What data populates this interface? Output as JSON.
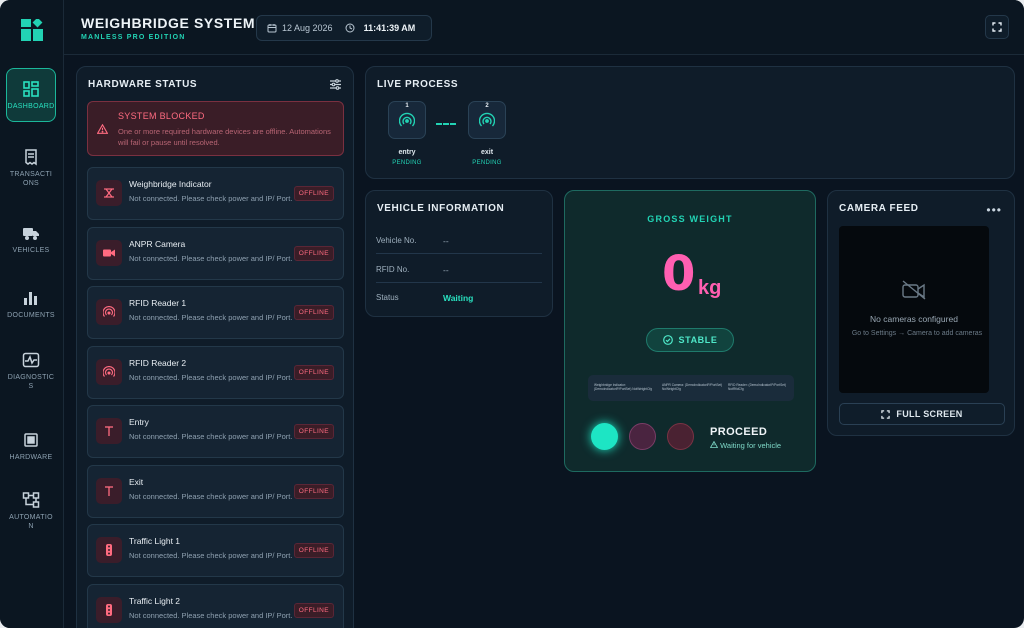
{
  "header": {
    "title": "WEIGHBRIDGE SYSTEM",
    "subtitle": "MANLESS PRO EDITION",
    "date": "12 Aug 2026",
    "time": "11:41:39 AM"
  },
  "sidebar": {
    "items": [
      {
        "label": "DASHBOARD",
        "icon": "dashboard-icon",
        "active": true
      },
      {
        "label": "TRANSACTIONS",
        "icon": "receipt-icon"
      },
      {
        "label": "VEHICLES",
        "icon": "truck-icon"
      },
      {
        "label": "DOCUMENTS",
        "icon": "bar-chart-icon"
      },
      {
        "label": "DIAGNOSTICS",
        "icon": "pulse-icon"
      },
      {
        "label": "HARDWARE",
        "icon": "chip-icon"
      },
      {
        "label": "AUTOMATION",
        "icon": "workflow-icon"
      }
    ]
  },
  "hardware": {
    "title": "HARDWARE STATUS",
    "alert": {
      "title": "SYSTEM BLOCKED",
      "message": "One or more required hardware devices are offline. Automations will fail or pause until resolved."
    },
    "devices": [
      {
        "name": "Weighbridge Indicator",
        "desc": "Not connected. Please check power and IP/ Port.",
        "status": "OFFLINE",
        "icon": "scale-icon"
      },
      {
        "name": "ANPR Camera",
        "desc": "Not connected. Please check power and IP/ Port.",
        "status": "OFFLINE",
        "icon": "video-icon"
      },
      {
        "name": "RFID Reader 1",
        "desc": "Not connected. Please check power and IP/ Port.",
        "status": "OFFLINE",
        "icon": "rfid-icon"
      },
      {
        "name": "RFID Reader 2",
        "desc": "Not connected. Please check power and IP/ Port.",
        "status": "OFFLINE",
        "icon": "rfid-icon"
      },
      {
        "name": "Entry",
        "desc": "Not connected. Please check power and IP/ Port.",
        "status": "OFFLINE",
        "icon": "barrier-icon"
      },
      {
        "name": "Exit",
        "desc": "Not connected. Please check power and IP/ Port.",
        "status": "OFFLINE",
        "icon": "barrier-icon"
      },
      {
        "name": "Traffic Light 1",
        "desc": "Not connected. Please check power and IP/ Port.",
        "status": "OFFLINE",
        "icon": "traffic-light-icon"
      },
      {
        "name": "Traffic Light 2",
        "desc": "Not connected. Please check power and IP/ Port.",
        "status": "OFFLINE",
        "icon": "traffic-light-icon"
      }
    ]
  },
  "live_process": {
    "title": "LIVE PROCESS",
    "steps": [
      {
        "num": "1",
        "name": "entry",
        "status": "PENDING"
      },
      {
        "num": "2",
        "name": "exit",
        "status": "PENDING"
      }
    ]
  },
  "vehicle": {
    "title": "VEHICLE INFORMATION",
    "rows": [
      {
        "key": "Vehicle No.",
        "value": "--"
      },
      {
        "key": "RFID No.",
        "value": "--"
      },
      {
        "key": "Status",
        "value": "Waiting"
      }
    ]
  },
  "weight": {
    "title": "GROSS WEIGHT",
    "value": "0",
    "unit": "kg",
    "stable_label": "STABLE",
    "devices": [
      "Weighbridge Indicator: (DemoIndicatorIP/PortSet) NotWeightCfg",
      "ANPR Camera: (DemoIndicatorIP/PortSet) NoWeightCfg",
      "RFID Reader: (DemoIndicatorIP/PortSet) NotRfidCfg"
    ],
    "lights": [
      "green",
      "amber",
      "red"
    ],
    "action": "PROCEED",
    "action_sub": "Waiting for vehicle"
  },
  "camera": {
    "title": "CAMERA FEED",
    "more": "•••",
    "empty_title": "No cameras configured",
    "empty_hint": "Go to Settings → Camera to add cameras",
    "fullscreen_label": "FULL SCREEN"
  },
  "colors": {
    "accent": "#22d3b4",
    "danger": "#ff6b80",
    "weight": "#ff5fb1",
    "background": "#0a1420"
  }
}
